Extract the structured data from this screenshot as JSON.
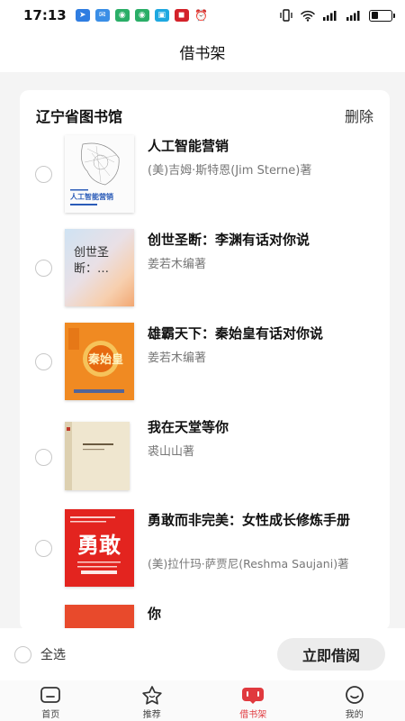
{
  "status_bar": {
    "time": "17:13",
    "app_icons": [
      "location-app-icon",
      "message-app-icon",
      "wechat-icon",
      "bilibili-icon",
      "news-app-icon",
      "alarm-icon"
    ],
    "signal_text_1": "4G",
    "battery_level": 0.35
  },
  "header": {
    "title": "借书架"
  },
  "library": {
    "name": "辽宁省图书馆",
    "delete_label": "删除"
  },
  "books": [
    {
      "title": "人工智能营销",
      "author": "(美)吉姆·斯特恩(Jim Sterne)著",
      "cover_text": "人工智能营销"
    },
    {
      "title": "创世圣断：李渊有话对你说",
      "author": "姜若木编著",
      "cover_text": "创世圣断：…"
    },
    {
      "title": "雄霸天下：秦始皇有话对你说",
      "author": "姜若木编著",
      "cover_text": "秦始皇"
    },
    {
      "title": "我在天堂等你",
      "author": "裘山山著",
      "cover_text": ""
    },
    {
      "title": "勇敢而非完美：女性成长修炼手册",
      "author": "(美)拉什玛·萨贾尼(Reshma Saujani)著",
      "cover_text": "勇敢"
    },
    {
      "title": "你",
      "author": "",
      "cover_text": ""
    }
  ],
  "footer": {
    "select_all_label": "全选",
    "borrow_label": "立即借阅"
  },
  "tabs": [
    {
      "label": "首页",
      "icon": "home-icon"
    },
    {
      "label": "推荐",
      "icon": "star-icon"
    },
    {
      "label": "借书架",
      "icon": "bookshelf-icon"
    },
    {
      "label": "我的",
      "icon": "profile-icon"
    }
  ],
  "colors": {
    "accent": "#e0393e",
    "text_primary": "#111111",
    "text_secondary": "#777777"
  }
}
